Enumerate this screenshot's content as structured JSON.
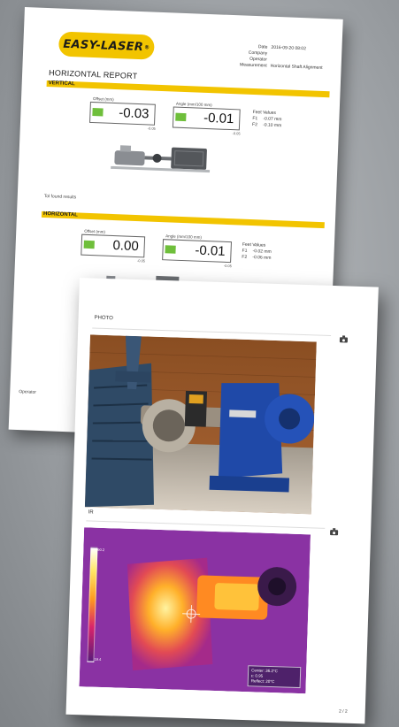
{
  "report": {
    "logo_text": "EASY-LASER",
    "logo_mark": "®",
    "meta": [
      {
        "key": "Date",
        "value": "2016-09-20 08:02"
      },
      {
        "key": "Company",
        "value": ""
      },
      {
        "key": "Operator",
        "value": ""
      },
      {
        "key": "Measurement",
        "value": "Horizontal Shaft Alignment"
      }
    ],
    "title": "HORIZONTAL REPORT",
    "vertical": {
      "section_label": "VERTICAL",
      "offset_label": "Offset (mm)",
      "offset_value": "-0.03",
      "offset_sub": "-0.05",
      "angle_label": "Angle (mm/100 mm)",
      "angle_value": "-0.01",
      "angle_sub": "-0.05",
      "feet_title": "Feet Values",
      "feet": [
        {
          "key": "F1",
          "value": "-0.07 mm"
        },
        {
          "key": "F2",
          "value": "-0.10 mm"
        }
      ]
    },
    "test_note": "Tol found results",
    "horizontal": {
      "section_label": "HORIZONTAL",
      "offset_label": "Offset (mm)",
      "offset_value": "0.00",
      "offset_sub": "-0.05",
      "angle_label": "Angle (mm/100 mm)",
      "angle_value": "-0.01",
      "angle_sub": "-0.05",
      "feet_title": "Feet Values",
      "feet": [
        {
          "key": "F1",
          "value": "-0.02 mm"
        },
        {
          "key": "F2",
          "value": "-0.06 mm"
        }
      ]
    },
    "operator_label": "Operator"
  },
  "photos": {
    "photo_title": "PHOTO",
    "ir_title": "IR",
    "ir_readout": [
      "Center: 36.2°C",
      "ε: 0.95",
      "Reflect: 20°C"
    ],
    "ir_scale_top": "60.2",
    "ir_scale_bottom": "19.4",
    "page_number": "2 / 2"
  },
  "colors": {
    "brand_yellow": "#f2c400",
    "status_green": "#6fbf3b"
  }
}
